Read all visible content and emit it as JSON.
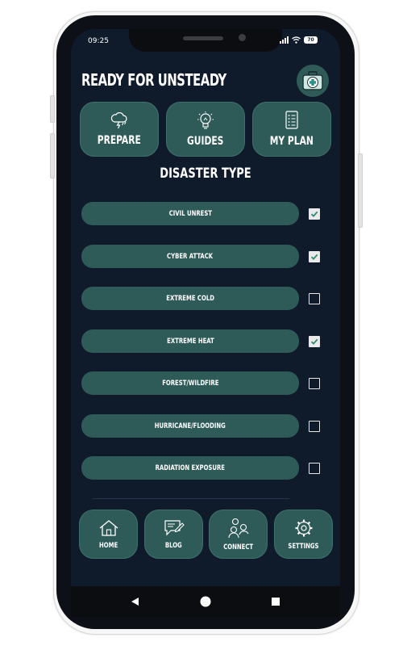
{
  "status_bar": {
    "time": "09:25",
    "battery": "70"
  },
  "app": {
    "title": "READY FOR UNSTEADY"
  },
  "top_buttons": [
    {
      "label": "PREPARE",
      "icon": "storm-cloud-icon"
    },
    {
      "label": "GUIDES",
      "icon": "lightbulb-icon"
    },
    {
      "label": "MY PLAN",
      "icon": "checklist-icon"
    }
  ],
  "section_title": "DISASTER TYPE",
  "disasters": [
    {
      "label": "CIVIL UNREST",
      "checked": true
    },
    {
      "label": "CYBER ATTACK",
      "checked": true
    },
    {
      "label": "EXTREME COLD",
      "checked": false
    },
    {
      "label": "EXTREME HEAT",
      "checked": true
    },
    {
      "label": "FOREST/WILDFIRE",
      "checked": false
    },
    {
      "label": "HURRICANE/FLOODING",
      "checked": false
    },
    {
      "label": "RADIATION EXPOSURE",
      "checked": false
    }
  ],
  "bottom_nav": [
    {
      "label": "HOME",
      "icon": "house-icon"
    },
    {
      "label": "BLOG",
      "icon": "chat-edit-icon"
    },
    {
      "label": "CONNECT",
      "icon": "people-icon"
    },
    {
      "label": "SETTINGS",
      "icon": "gear-icon"
    }
  ],
  "colors": {
    "background": "#0f1a2b",
    "button": "#2e5b58",
    "text": "#ffffff",
    "checkbox": "#e9e9e9"
  }
}
